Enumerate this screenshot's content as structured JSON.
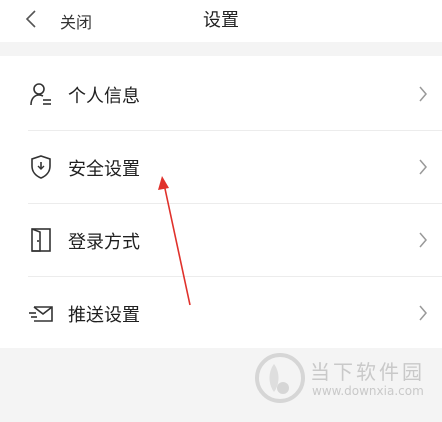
{
  "header": {
    "close_label": "关闭",
    "title": "设置"
  },
  "menu": {
    "items": [
      {
        "label": "个人信息",
        "icon": "person-icon"
      },
      {
        "label": "安全设置",
        "icon": "shield-icon"
      },
      {
        "label": "登录方式",
        "icon": "door-icon"
      },
      {
        "label": "推送设置",
        "icon": "envelope-icon"
      }
    ]
  },
  "annotation": {
    "color": "#e0312b"
  },
  "watermark": {
    "title": "当下软件园",
    "url": "www.downxia.com"
  }
}
